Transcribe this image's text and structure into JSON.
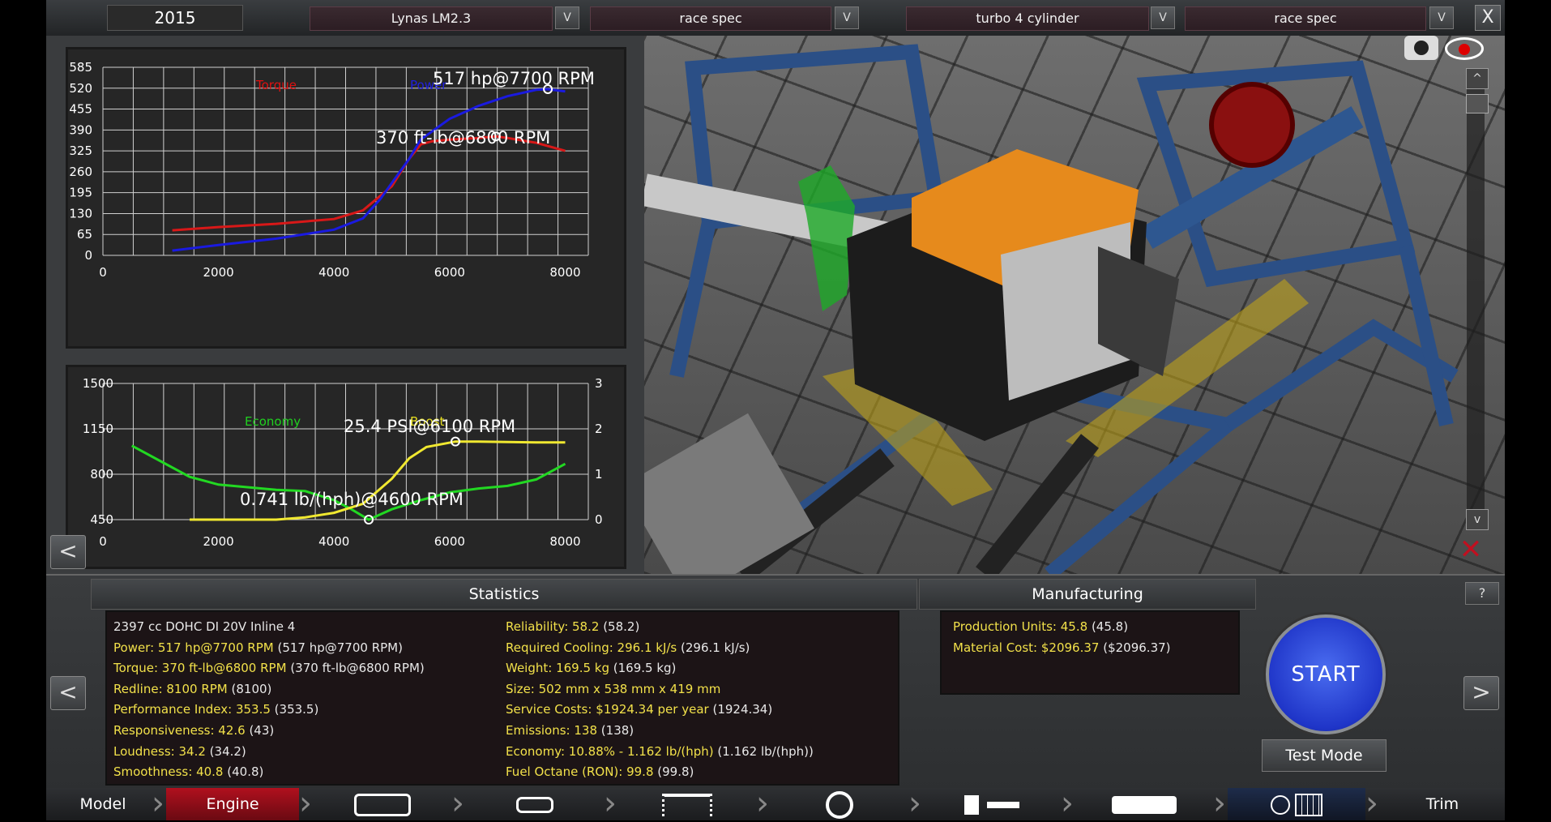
{
  "topbar": {
    "year": "2015",
    "dropdowns": [
      {
        "value": "Lynas LM2.3"
      },
      {
        "value": "race spec"
      },
      {
        "value": "turbo 4 cylinder"
      },
      {
        "value": "race spec"
      }
    ],
    "dropdown_button_label": "V",
    "close_label": "X"
  },
  "chart_top": {
    "type": "line",
    "x_ticks": [
      "0",
      "2000",
      "4000",
      "6000",
      "8000"
    ],
    "y_ticks": [
      "0",
      "65",
      "130",
      "195",
      "260",
      "325",
      "390",
      "455",
      "520",
      "585"
    ],
    "xlim": [
      0,
      8400
    ],
    "ylim": [
      0,
      585
    ],
    "legend": [
      {
        "name": "Torque",
        "color": "#e01010"
      },
      {
        "name": "Power",
        "color": "#2020e0"
      }
    ],
    "peak_power_label": "517 hp@7700 RPM",
    "peak_torque_label": "370 ft-lb@6800 RPM",
    "series": [
      {
        "name": "Torque",
        "color": "#d81818",
        "x": [
          1200,
          2000,
          3000,
          4000,
          4500,
          5000,
          5300,
          5500,
          5700,
          6000,
          6500,
          6800,
          7000,
          7500,
          8000
        ],
        "y": [
          78,
          88,
          98,
          113,
          140,
          215,
          300,
          345,
          355,
          360,
          365,
          370,
          365,
          350,
          325
        ]
      },
      {
        "name": "Power",
        "color": "#1a1ae0",
        "x": [
          1200,
          2000,
          3000,
          4000,
          4500,
          4800,
          5000,
          5300,
          5500,
          6000,
          6500,
          7000,
          7500,
          7700,
          8000
        ],
        "y": [
          15,
          32,
          52,
          80,
          115,
          175,
          225,
          300,
          360,
          425,
          465,
          495,
          515,
          517,
          510
        ]
      }
    ],
    "markers": [
      {
        "x": 7700,
        "y": 517
      },
      {
        "x": 6800,
        "y": 370
      }
    ]
  },
  "chart_bottom": {
    "type": "line",
    "x_ticks": [
      "0",
      "2000",
      "4000",
      "6000",
      "8000"
    ],
    "y_ticks_left": [
      "450",
      "800",
      "1150",
      "1500"
    ],
    "y_ticks_right": [
      "0",
      "1",
      "2",
      "3"
    ],
    "xlim": [
      0,
      8400
    ],
    "ylim_left": [
      450,
      1500
    ],
    "ylim_right": [
      0,
      3
    ],
    "legend": [
      {
        "name": "Economy",
        "color": "#20d020"
      },
      {
        "name": "Boost",
        "color": "#e8e020"
      }
    ],
    "boost_label": "25.4 PSI@6100 RPM",
    "economy_label": "0.741 lb/(hph)@4600 RPM",
    "series": [
      {
        "name": "Economy",
        "color": "#22d822",
        "axis": "left",
        "x": [
          500,
          1000,
          1500,
          2000,
          2500,
          3000,
          3500,
          4000,
          4300,
          4600,
          5000,
          5500,
          6000,
          6500,
          7000,
          7500,
          8000
        ],
        "y": [
          1020,
          900,
          780,
          720,
          700,
          680,
          670,
          600,
          530,
          450,
          530,
          600,
          660,
          690,
          710,
          760,
          880
        ]
      },
      {
        "name": "Boost",
        "color": "#f0e830",
        "axis": "right",
        "x": [
          1500,
          2000,
          2500,
          3000,
          3500,
          4000,
          4500,
          5000,
          5300,
          5600,
          6100,
          6500,
          7000,
          7500,
          8000
        ],
        "y": [
          0,
          0,
          0,
          0,
          0.05,
          0.15,
          0.35,
          0.9,
          1.35,
          1.6,
          1.72,
          1.72,
          1.71,
          1.7,
          1.7
        ]
      }
    ],
    "markers": [
      {
        "x": 6100,
        "y": 1.72,
        "axis": "right"
      },
      {
        "x": 4600,
        "y": 450,
        "axis": "left"
      }
    ]
  },
  "left_nav_label": "<",
  "view3d": {
    "scroll_up_label": "^",
    "scroll_down_label": "v"
  },
  "statistics": {
    "header": "Statistics",
    "left_col": [
      {
        "label": "2397 cc DOHC DI 20V Inline 4",
        "paren": ""
      },
      {
        "label": "Power: 517 hp@7700 RPM",
        "paren": "(517 hp@7700 RPM)"
      },
      {
        "label": "Torque: 370 ft-lb@6800 RPM",
        "paren": "(370 ft-lb@6800 RPM)"
      },
      {
        "label": "Redline: 8100 RPM",
        "paren": "(8100)"
      },
      {
        "label": "Performance Index: 353.5",
        "paren": "(353.5)"
      },
      {
        "label": "Responsiveness: 42.6",
        "paren": "(43)"
      },
      {
        "label": "Loudness: 34.2",
        "paren": "(34.2)"
      },
      {
        "label": "Smoothness: 40.8",
        "paren": "(40.8)"
      }
    ],
    "right_col": [
      {
        "label": "Reliability: 58.2",
        "paren": "(58.2)"
      },
      {
        "label": "Required Cooling: 296.1 kJ/s",
        "paren": "(296.1 kJ/s)"
      },
      {
        "label": "Weight: 169.5 kg",
        "paren": "(169.5 kg)"
      },
      {
        "label": "Size: 502 mm x 538 mm x 419 mm",
        "paren": ""
      },
      {
        "label": "Service Costs: $1924.34 per year",
        "paren": "(1924.34)"
      },
      {
        "label": "Emissions: 138",
        "paren": "(138)"
      },
      {
        "label": "Economy: 10.88% - 1.162 lb/(hph)",
        "paren": "(1.162 lb/(hph))"
      },
      {
        "label": "Fuel Octane (RON): 99.8",
        "paren": "(99.8)"
      }
    ]
  },
  "manufacturing": {
    "header": "Manufacturing",
    "rows": [
      {
        "label": "Production Units: 45.8",
        "paren": "(45.8)"
      },
      {
        "label": "Material Cost: $2096.37",
        "paren": "($2096.37)"
      }
    ]
  },
  "help_label": "?",
  "prev_label": "<",
  "next_label": ">",
  "start_label": "START",
  "test_mode_label": "Test Mode",
  "tabs": [
    {
      "label": "Model"
    },
    {
      "label": "Engine"
    },
    {
      "label": "Trim"
    }
  ],
  "tab_icons": [
    "block-icon",
    "crank-icon",
    "heads-icon",
    "turbo-icon",
    "fuel-icon",
    "exhaust-icon",
    "dyno-icon"
  ],
  "colors": {
    "accent_red": "#c01020",
    "stat_text": "#f2e14a",
    "start_blue": "#2a40d8"
  }
}
